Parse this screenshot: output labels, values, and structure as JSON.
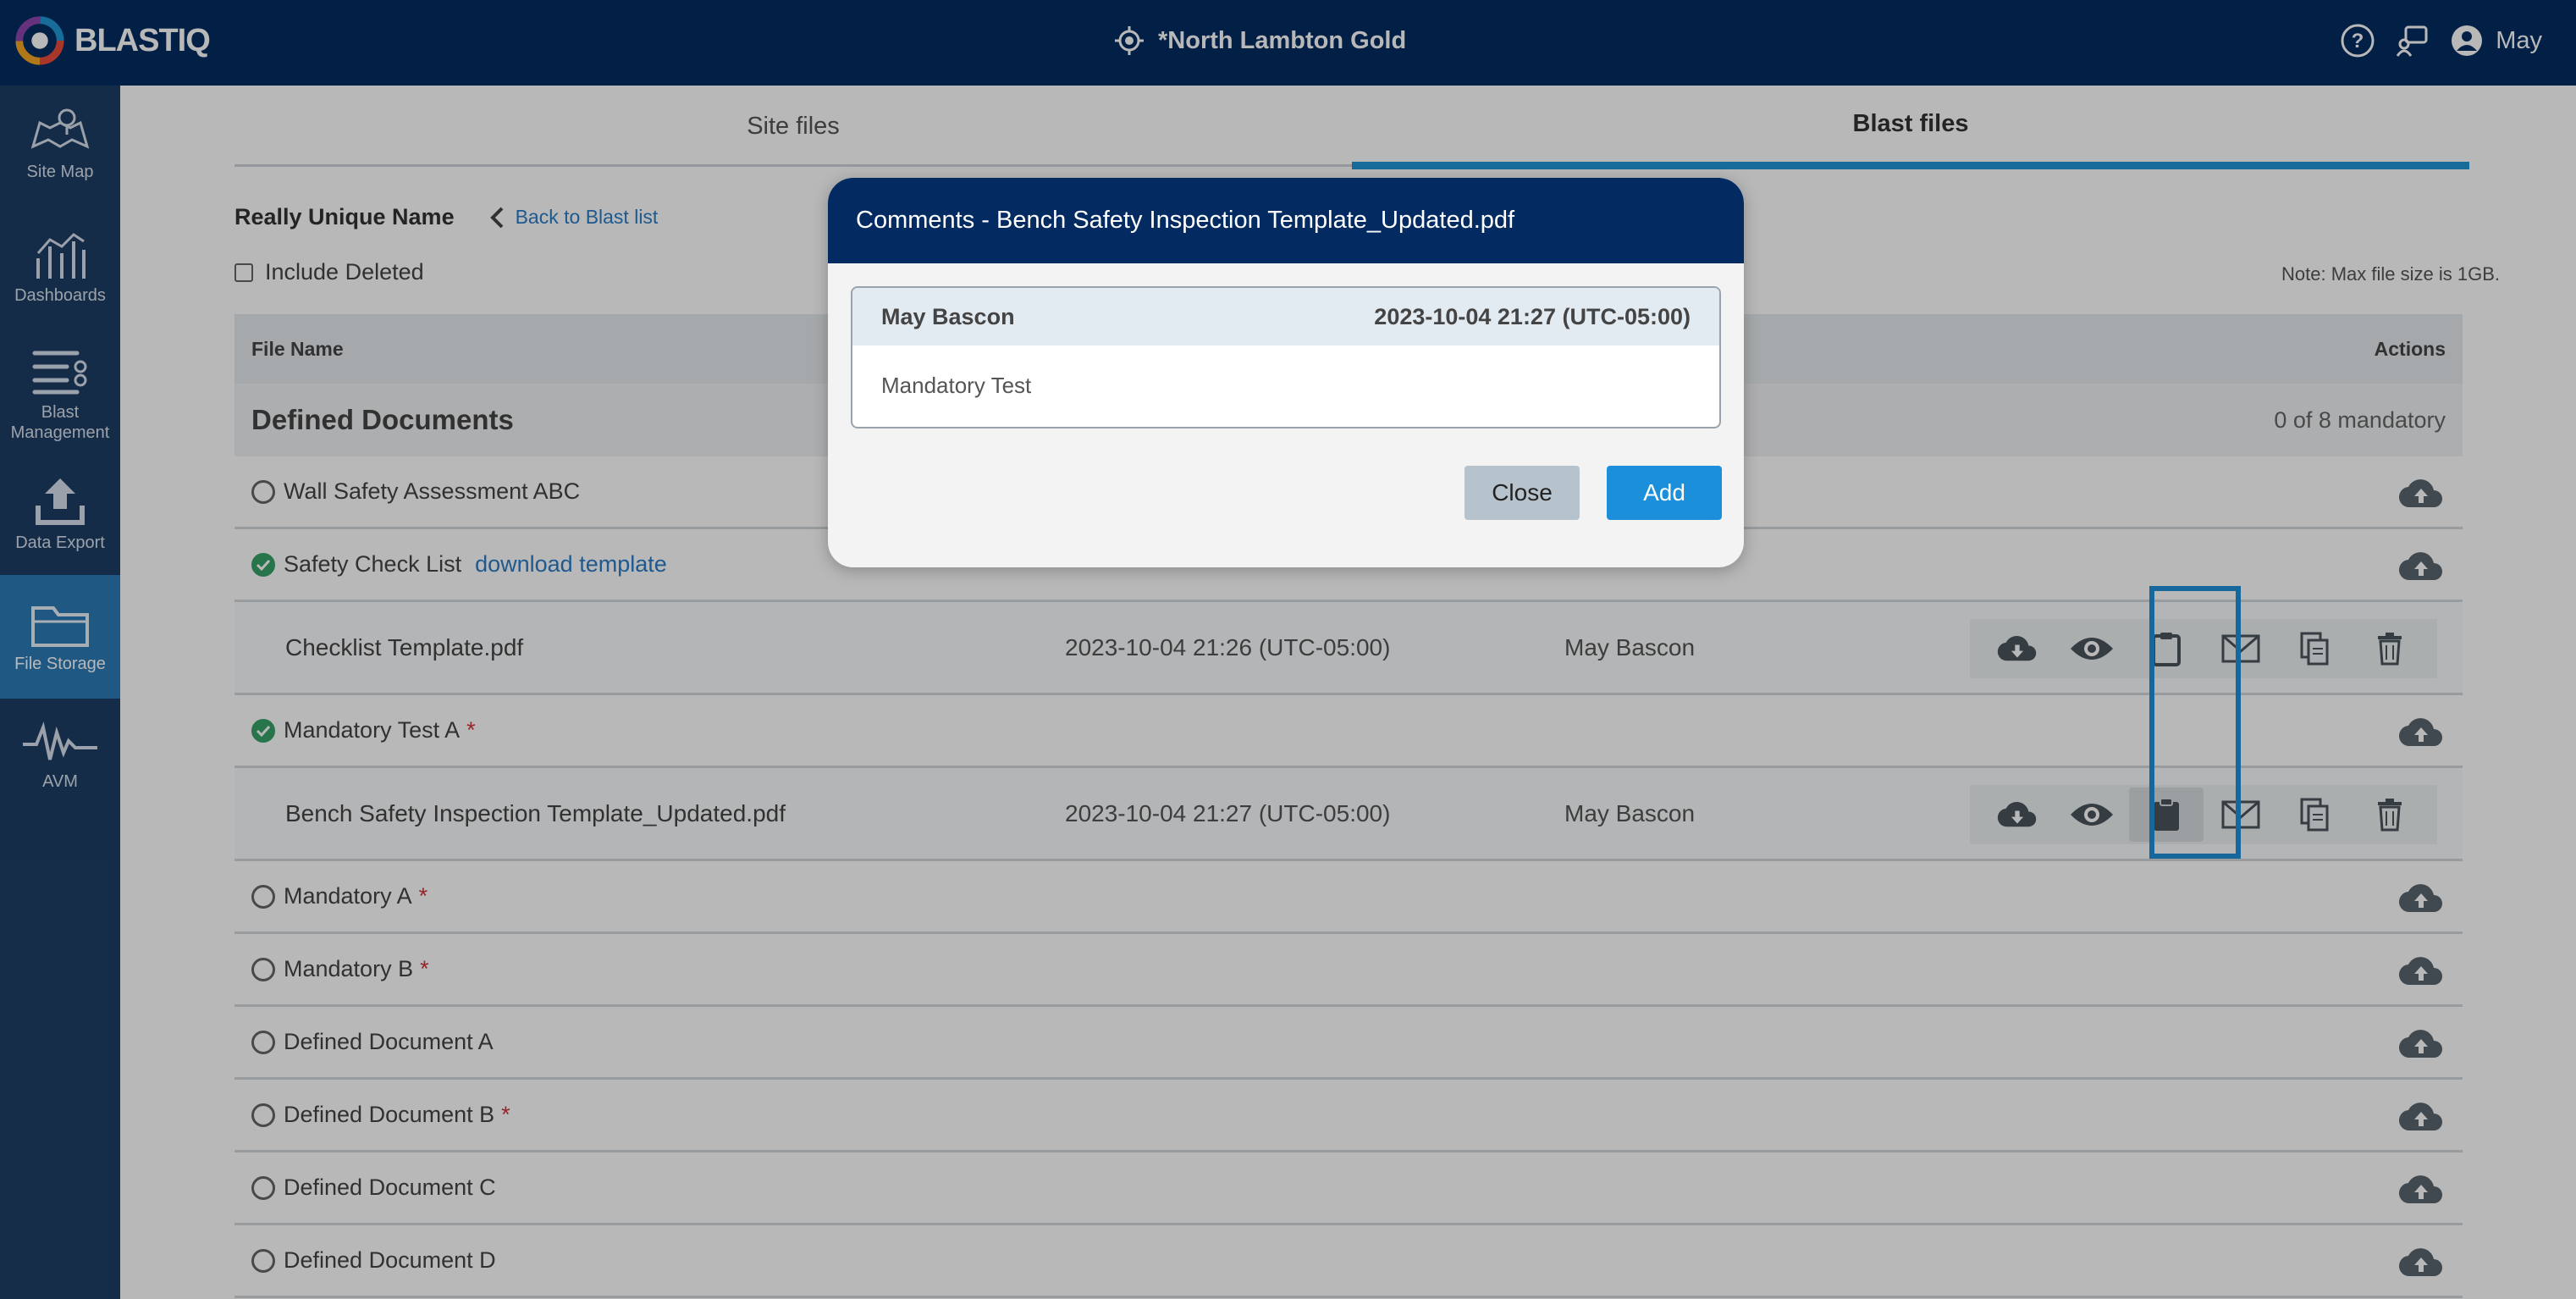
{
  "app": {
    "logo_text": "BLASTIQ",
    "site_name": "*North Lambton Gold",
    "user_name": "May"
  },
  "sidebar": {
    "items": [
      {
        "label": "Site Map",
        "icon": "map-icon"
      },
      {
        "label": "Dashboards",
        "icon": "dashboard-icon"
      },
      {
        "label": "Blast Management",
        "icon": "blast-management-icon"
      },
      {
        "label": "Data Export",
        "icon": "upload-icon"
      },
      {
        "label": "File Storage",
        "icon": "folder-icon",
        "active": true
      },
      {
        "label": "AVM",
        "icon": "waveform-icon"
      }
    ]
  },
  "tabs": {
    "site_files": "Site files",
    "blast_files": "Blast files"
  },
  "header": {
    "title": "Really Unique Name",
    "back_link": "Back to Blast list",
    "include_deleted": "Include Deleted",
    "note": "Note: Max file size is 1GB."
  },
  "table": {
    "col_file_name": "File Name",
    "col_actions": "Actions",
    "section_title": "Defined Documents",
    "section_count": "0 of 8 mandatory",
    "rows": {
      "wall_safety": "Wall Safety Assessment ABC",
      "safety_check": "Safety Check List",
      "download_template": "download template",
      "checklist_file": "Checklist Template.pdf",
      "checklist_date": "2023-10-04 21:26 (UTC-05:00)",
      "checklist_user": "May Bascon",
      "mandatory_test_a": "Mandatory Test A",
      "bench_file": "Bench Safety Inspection Template_Updated.pdf",
      "bench_date": "2023-10-04 21:27 (UTC-05:00)",
      "bench_user": "May Bascon",
      "mandatory_a": "Mandatory A",
      "mandatory_b": "Mandatory B",
      "defined_a": "Defined Document A",
      "defined_b": "Defined Document B",
      "defined_c": "Defined Document C",
      "defined_d": "Defined Document D",
      "required_mark": "*"
    }
  },
  "modal": {
    "title": "Comments - Bench Safety Inspection Template_Updated.pdf",
    "comment_author": "May Bascon",
    "comment_date": "2023-10-04 21:27 (UTC-05:00)",
    "comment_text": "Mandatory Test",
    "close_label": "Close",
    "add_label": "Add"
  },
  "colors": {
    "brand_navy": "#032b62",
    "sidebar": "#1e3e64",
    "sidebar_active": "#2b7bb4",
    "accent_blue": "#1b8fd9",
    "success_green": "#38a169",
    "required_red": "#d0343a"
  }
}
